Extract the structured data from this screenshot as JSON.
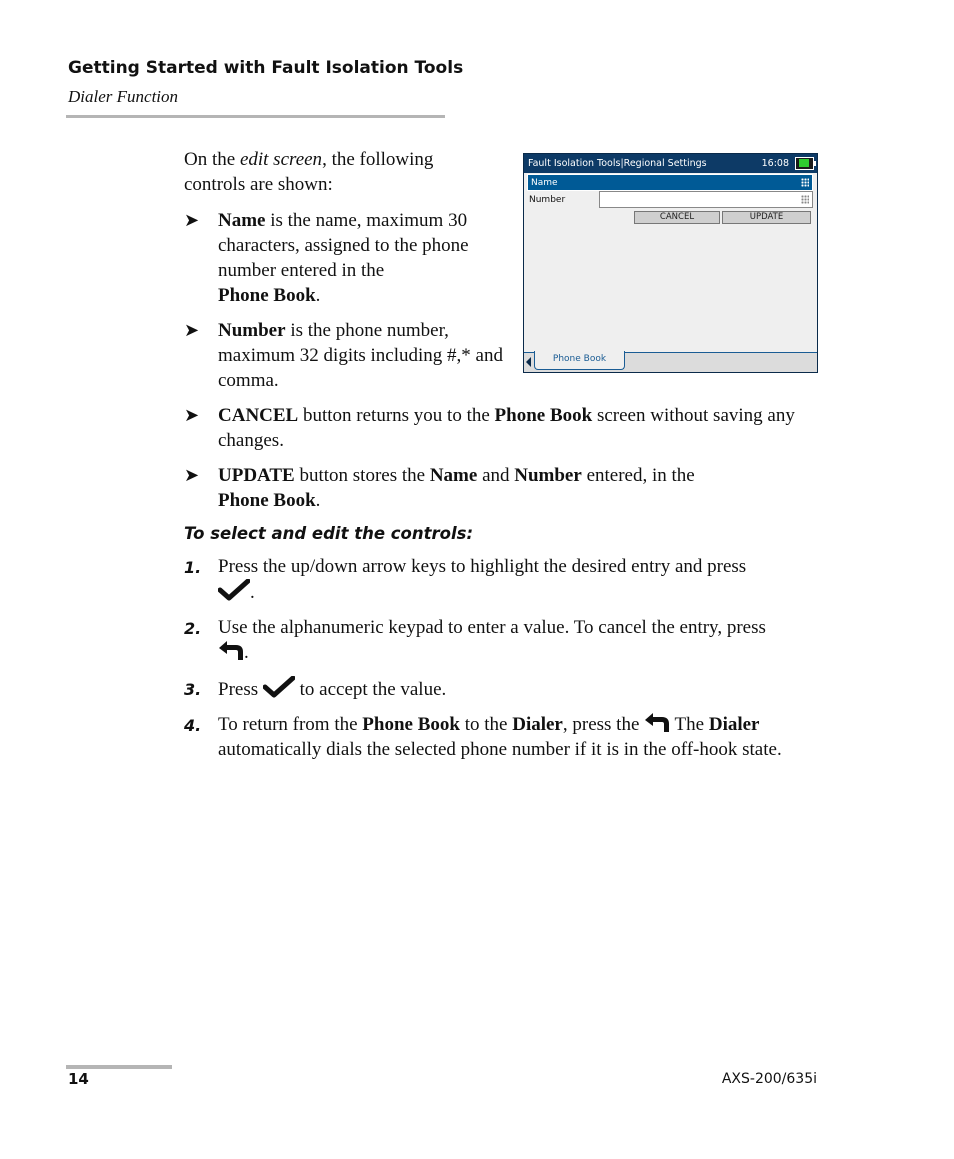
{
  "header": {
    "title": "Getting Started with Fault Isolation Tools",
    "subtitle": "Dialer Function"
  },
  "intro": {
    "prefix": "On the ",
    "emphasis": "edit screen",
    "suffix": ", the following controls are shown:"
  },
  "bullets": [
    {
      "bold": "Name",
      "text": " is the name, maximum 30 characters, assigned to the phone number entered in the ",
      "bold2": "Phone Book",
      "tail": "."
    },
    {
      "bold": "Number",
      "text": " is the phone number, maximum 32 digits including #,* and comma.",
      "bold2": "",
      "tail": ""
    },
    {
      "bold": "CANCEL",
      "text": " button returns you to the ",
      "bold2": "Phone Book",
      "tail": " screen without saving any changes."
    },
    {
      "bold": "UPDATE",
      "text": " button stores the ",
      "bold2": "Name",
      "mid": " and ",
      "bold3": "Number",
      "tail": " entered, in the ",
      "bold4": "Phone Book",
      "end": "."
    }
  ],
  "procedure": {
    "title": "To select and edit the controls:",
    "steps": [
      {
        "num": "1.",
        "text": "Press the up/down arrow keys to highlight the desired entry and press",
        "icon": "checkmark-icon",
        "tail": "."
      },
      {
        "num": "2.",
        "text": "Use the alphanumeric keypad to enter a value. To cancel the entry, press",
        "icon": "back-arrow-icon",
        "tail": "."
      },
      {
        "num": "3.",
        "text": "Press",
        "icon": "checkmark-icon",
        "tail": "to accept the value."
      },
      {
        "num": "4.",
        "text": "To return from the ",
        "b1": "Phone Book",
        "t2": " to the ",
        "b2": "Dialer",
        "t3": ", press the",
        "icon": "back-arrow-icon",
        "t4": " The ",
        "b3": "Dialer",
        "t5": " automatically dials the selected phone number if it is in the off-hook state."
      }
    ]
  },
  "device": {
    "title": "Fault Isolation Tools|Regional Settings",
    "time": "16:08",
    "battery_icon": "battery-charging-icon",
    "fields": [
      {
        "label": "Name",
        "value": "",
        "selected": true
      },
      {
        "label": "Number",
        "value": "",
        "selected": false
      }
    ],
    "buttons": {
      "cancel": "CANCEL",
      "update": "UPDATE"
    },
    "tab": "Phone Book",
    "colors": {
      "titlebar": "#0d3a66",
      "selected_row": "#005a96",
      "tab_text": "#1a5c94"
    }
  },
  "footer": {
    "page_number": "14",
    "model": "AXS-200/635i"
  }
}
